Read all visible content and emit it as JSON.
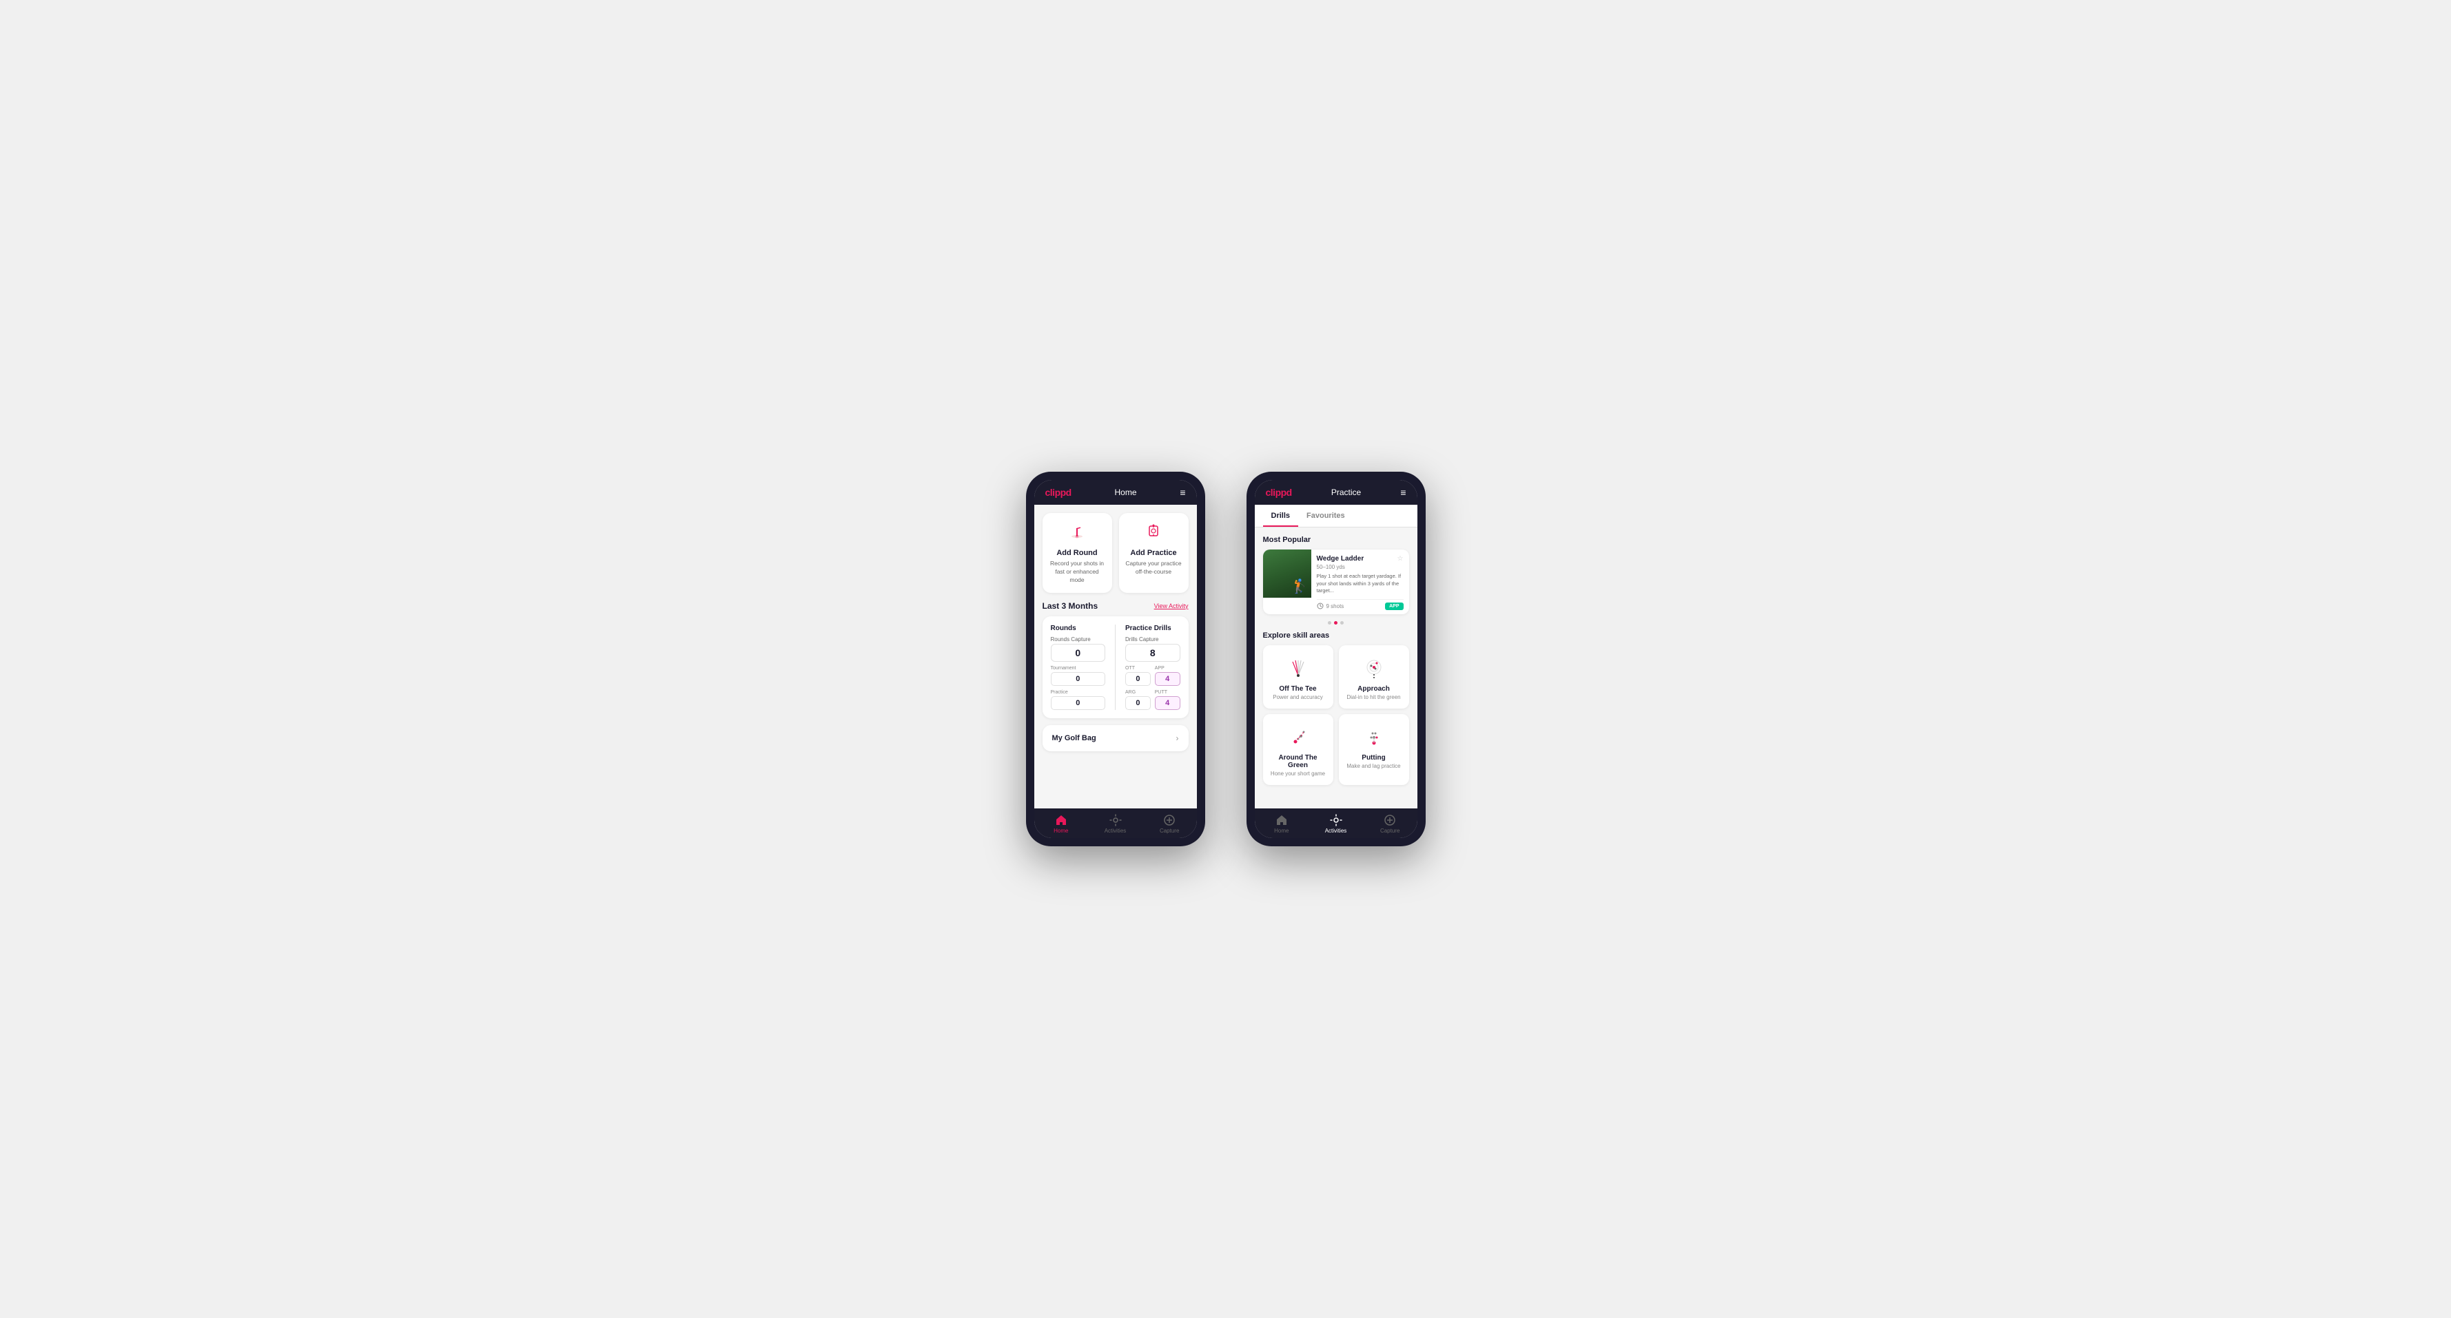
{
  "phone1": {
    "topbar": {
      "logo": "clippd",
      "title": "Home",
      "menu": "≡"
    },
    "actions": [
      {
        "id": "add-round",
        "title": "Add Round",
        "desc": "Record your shots in fast or enhanced mode",
        "icon": "flag"
      },
      {
        "id": "add-practice",
        "title": "Add Practice",
        "desc": "Capture your practice off-the-course",
        "icon": "target"
      }
    ],
    "activity": {
      "section_title": "Last 3 Months",
      "view_link": "View Activity",
      "rounds": {
        "title": "Rounds",
        "capture_label": "Rounds Capture",
        "capture_value": "0",
        "tournament_label": "Tournament",
        "tournament_value": "0",
        "practice_label": "Practice",
        "practice_value": "0"
      },
      "drills": {
        "title": "Practice Drills",
        "capture_label": "Drills Capture",
        "capture_value": "8",
        "ott_label": "OTT",
        "ott_value": "0",
        "app_label": "APP",
        "app_value": "4",
        "arg_label": "ARG",
        "arg_value": "0",
        "putt_label": "PUTT",
        "putt_value": "4"
      }
    },
    "golf_bag": {
      "label": "My Golf Bag"
    },
    "nav": [
      {
        "label": "Home",
        "active": true,
        "icon": "home"
      },
      {
        "label": "Activities",
        "active": false,
        "icon": "activities"
      },
      {
        "label": "Capture",
        "active": false,
        "icon": "capture"
      }
    ]
  },
  "phone2": {
    "topbar": {
      "logo": "clippd",
      "title": "Practice",
      "menu": "≡"
    },
    "tabs": [
      {
        "label": "Drills",
        "active": true
      },
      {
        "label": "Favourites",
        "active": false
      }
    ],
    "most_popular": {
      "title": "Most Popular",
      "drill": {
        "name": "Wedge Ladder",
        "yardage": "50–100 yds",
        "desc": "Play 1 shot at each target yardage. If your shot lands within 3 yards of the target...",
        "shots": "9 shots",
        "badge": "APP"
      }
    },
    "dots": [
      false,
      true,
      false
    ],
    "explore": {
      "title": "Explore skill areas",
      "skills": [
        {
          "name": "Off The Tee",
          "desc": "Power and accuracy",
          "icon": "tee"
        },
        {
          "name": "Approach",
          "desc": "Dial-in to hit the green",
          "icon": "approach"
        },
        {
          "name": "Around The Green",
          "desc": "Hone your short game",
          "icon": "atg"
        },
        {
          "name": "Putting",
          "desc": "Make and lag practice",
          "icon": "putting"
        }
      ]
    },
    "nav": [
      {
        "label": "Home",
        "active": false,
        "icon": "home"
      },
      {
        "label": "Activities",
        "active": true,
        "icon": "activities"
      },
      {
        "label": "Capture",
        "active": false,
        "icon": "capture"
      }
    ]
  }
}
